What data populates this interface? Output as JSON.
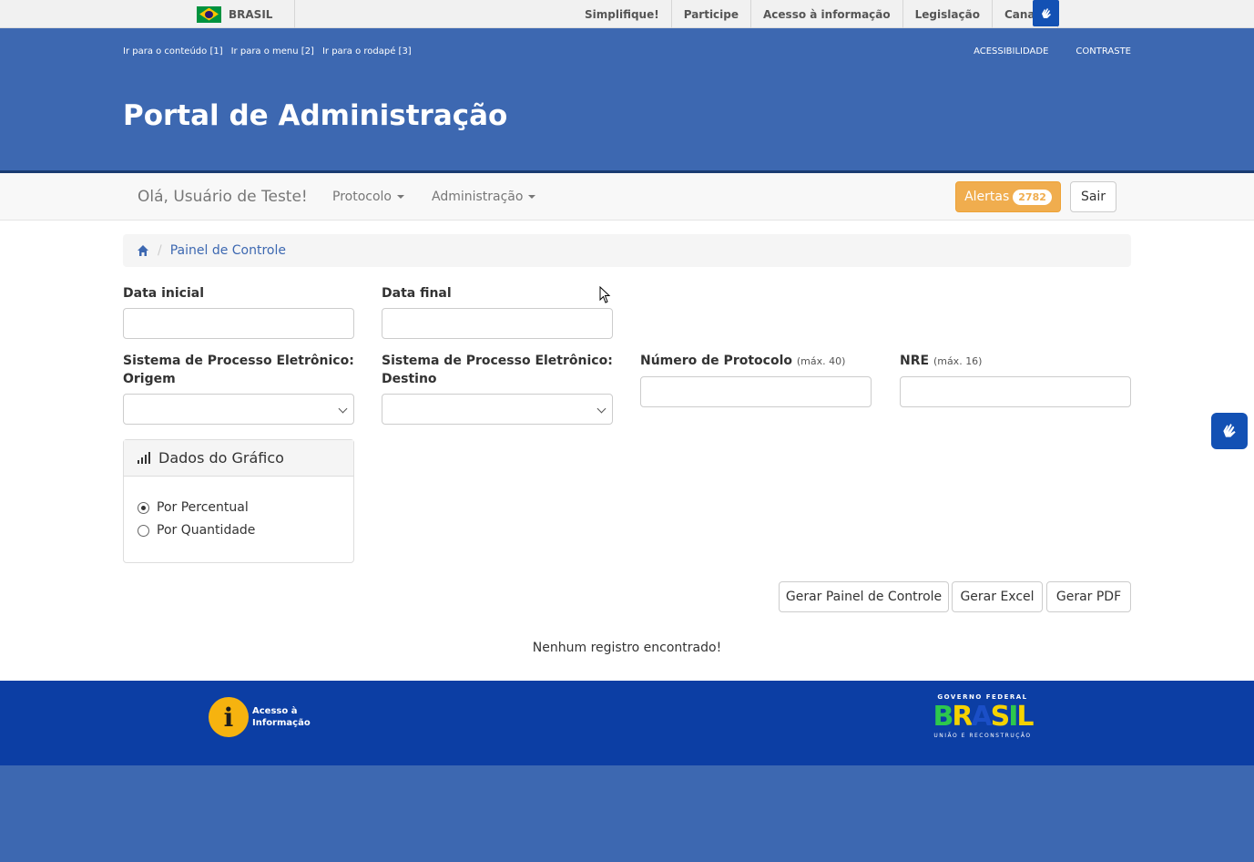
{
  "govbar": {
    "country": "BRASIL",
    "links": [
      "Simplifique!",
      "Participe",
      "Acesso à informação",
      "Legislação",
      "Canais"
    ]
  },
  "header": {
    "skip_links": [
      "Ir para o conteúdo [1]",
      "Ir para o menu [2]",
      "Ir para o rodapé [3]"
    ],
    "accessibility": "ACESSIBILIDADE",
    "contrast": "CONTRASTE",
    "title": "Portal de Administração"
  },
  "navbar": {
    "greeting": "Olá, Usuário de Teste!",
    "menu": [
      "Protocolo",
      "Administração"
    ],
    "alerts_label": "Alertas",
    "alerts_count": "2782",
    "logout": "Sair"
  },
  "breadcrumb": {
    "current": "Painel de Controle"
  },
  "form": {
    "data_inicial": {
      "label": "Data inicial",
      "value": ""
    },
    "data_final": {
      "label": "Data final",
      "value": ""
    },
    "spe_origem": {
      "label": "Sistema de Processo Eletrônico: Origem",
      "value": ""
    },
    "spe_destino": {
      "label": "Sistema de Processo Eletrônico: Destino",
      "value": ""
    },
    "protocolo": {
      "label": "Número de Protocolo",
      "hint": "(máx. 40)",
      "value": ""
    },
    "nre": {
      "label": "NRE",
      "hint": "(máx. 16)",
      "value": ""
    }
  },
  "chart_panel": {
    "title": "Dados do Gráfico",
    "options": [
      {
        "label": "Por Percentual",
        "checked": true
      },
      {
        "label": "Por Quantidade",
        "checked": false
      }
    ]
  },
  "actions": {
    "gerar_painel": "Gerar Painel de Controle",
    "gerar_excel": "Gerar Excel",
    "gerar_pdf": "Gerar PDF"
  },
  "empty_message": "Nenhum registro encontrado!",
  "footer": {
    "acesso_info": [
      "Acesso à",
      "Informação"
    ],
    "gov_logo_top": "GOVERNO FEDERAL",
    "gov_logo_word": "BRASIL",
    "gov_logo_bottom": "UNIÃO E RECONSTRUÇÃO"
  },
  "colors": {
    "header_blue": "#3d68b1",
    "footer_blue": "#0c3ea4",
    "alert_orange": "#f0ad4e",
    "vlibras_blue": "#1351b4"
  },
  "icons": [
    "flag-icon",
    "vlibras-icon",
    "home-icon",
    "bar-chart-icon",
    "caret-down-icon",
    "select-arrow-icon",
    "cursor-icon",
    "info-icon"
  ]
}
